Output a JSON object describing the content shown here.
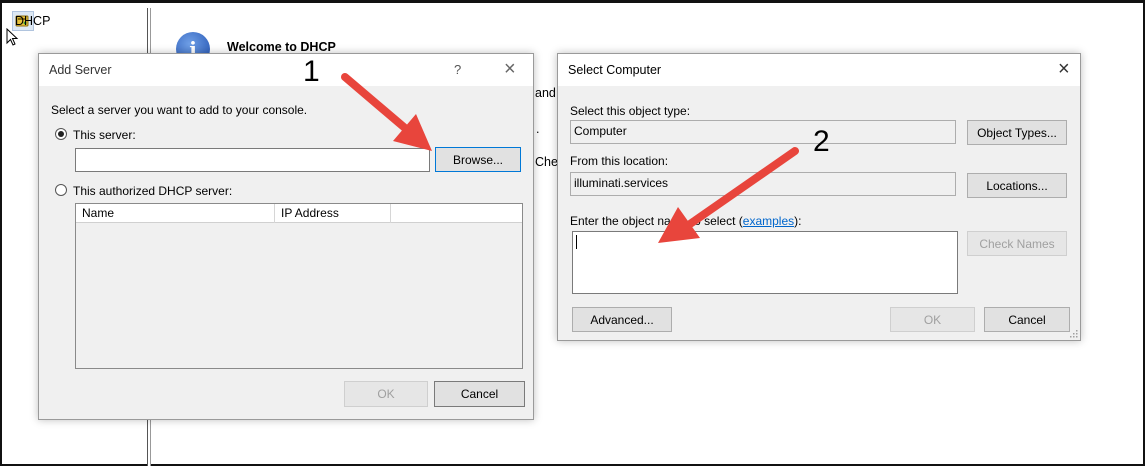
{
  "tree": {
    "root_label": "DHCP",
    "root_icon": "dhcp-server-icon"
  },
  "background": {
    "welcome_title": "Welcome to DHCP",
    "frag_and": "and",
    "frag_dot": ".",
    "frag_che": "Che"
  },
  "add_server": {
    "title": "Add Server",
    "help": "?",
    "close": "×",
    "prompt": "Select a server you want to add to your console.",
    "radio_this_server": "This server:",
    "this_server_value": "",
    "browse_label": "Browse...",
    "radio_authorized": "This authorized DHCP server:",
    "columns": [
      "Name",
      "IP Address",
      ""
    ],
    "rows": [],
    "ok_label": "OK",
    "cancel_label": "Cancel"
  },
  "select_computer": {
    "title": "Select Computer",
    "close": "×",
    "object_type_label": "Select this object type:",
    "object_type_value": "Computer",
    "object_types_button": "Object Types...",
    "location_label": "From this location:",
    "location_value": "illuminati.services",
    "locations_button": "Locations...",
    "enter_label_prefix": "Enter the object na",
    "enter_label_hidden": "me t",
    "enter_label_suffix": "o select (",
    "examples_link": "examples",
    "enter_label_end": "):",
    "object_names_value": "",
    "check_names_button": "Check Names",
    "advanced_button": "Advanced...",
    "ok_label": "OK",
    "cancel_label": "Cancel"
  },
  "annotations": {
    "step1": "1",
    "step2": "2",
    "arrow_color": "#e8453c"
  }
}
